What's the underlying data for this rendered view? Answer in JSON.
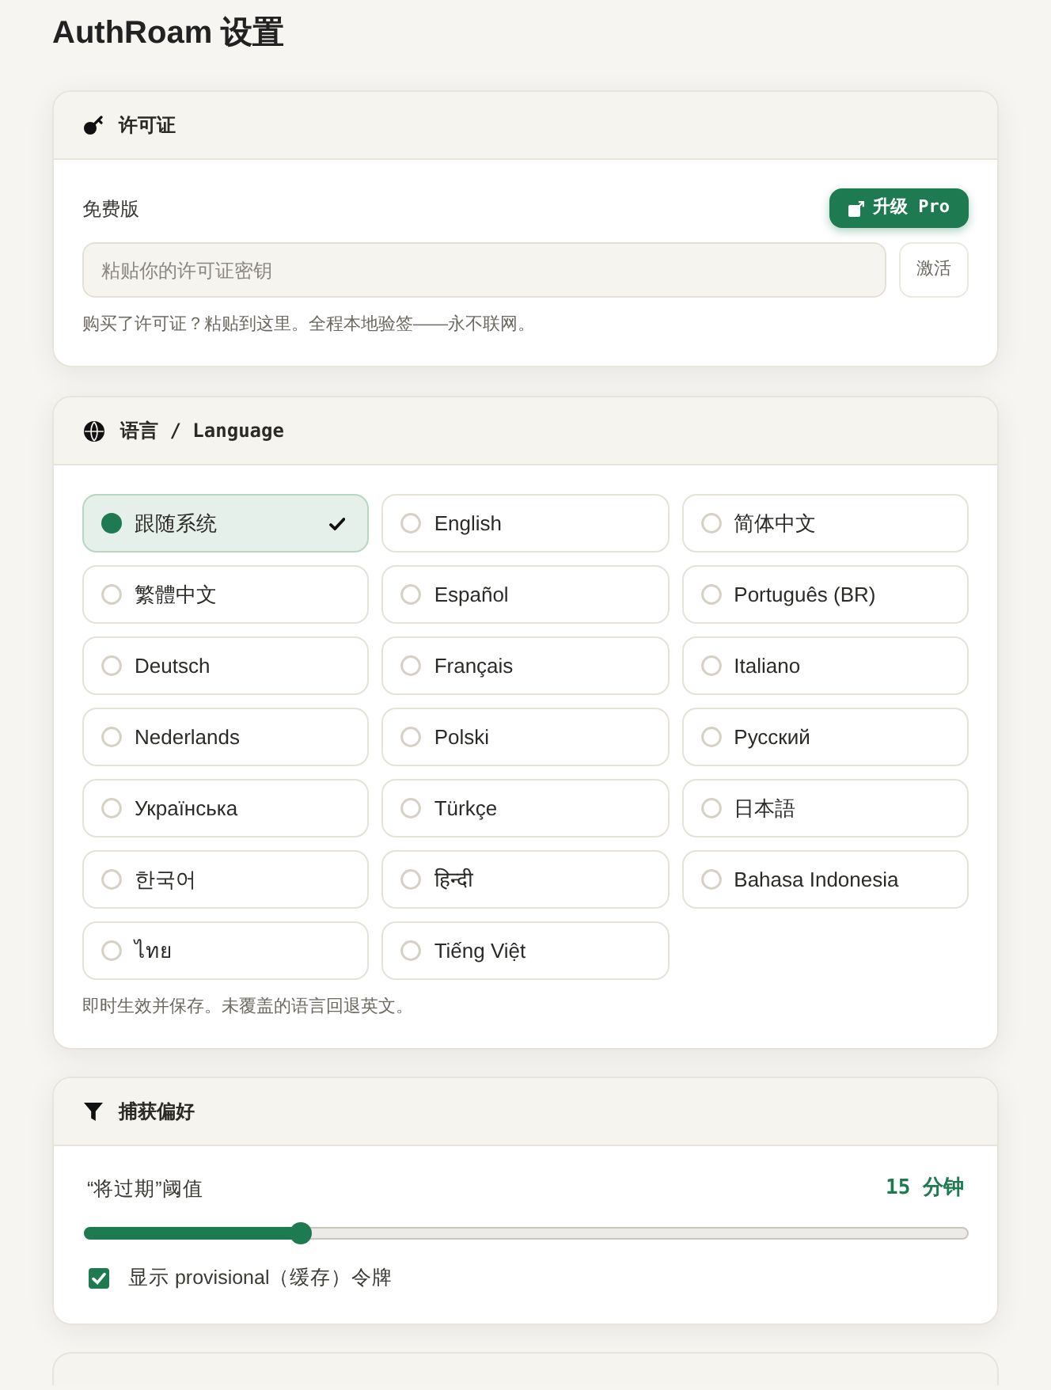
{
  "page": {
    "title": "AuthRoam 设置"
  },
  "license": {
    "header": {
      "title": "许可证"
    },
    "plan": "免费版",
    "upgrade_button": "升级 Pro",
    "key_field": {
      "placeholder": "粘贴你的许可证密钥"
    },
    "activate_button": "激活",
    "hint": "购买了许可证？粘贴到这里。全程本地验签——永不联网。"
  },
  "language": {
    "header": {
      "title": "语言 / Language"
    },
    "options": [
      {
        "label": "跟随系统",
        "selected": true
      },
      {
        "label": "English",
        "selected": false
      },
      {
        "label": "简体中文",
        "selected": false
      },
      {
        "label": "繁體中文",
        "selected": false
      },
      {
        "label": "Español",
        "selected": false
      },
      {
        "label": "Português (BR)",
        "selected": false
      },
      {
        "label": "Deutsch",
        "selected": false
      },
      {
        "label": "Français",
        "selected": false
      },
      {
        "label": "Italiano",
        "selected": false
      },
      {
        "label": "Nederlands",
        "selected": false
      },
      {
        "label": "Polski",
        "selected": false
      },
      {
        "label": "Русский",
        "selected": false
      },
      {
        "label": "Українська",
        "selected": false
      },
      {
        "label": "Türkçe",
        "selected": false
      },
      {
        "label": "日本語",
        "selected": false
      },
      {
        "label": "한국어",
        "selected": false
      },
      {
        "label": "हिन्दी",
        "selected": false
      },
      {
        "label": "Bahasa Indonesia",
        "selected": false
      },
      {
        "label": "ไทย",
        "selected": false
      },
      {
        "label": "Tiếng Việt",
        "selected": false
      }
    ],
    "hint": "即时生效并保存。未覆盖的语言回退英文。"
  },
  "capture": {
    "header": {
      "title": "捕获偏好"
    },
    "threshold": {
      "label": "“将过期”阈值",
      "reading": "15 分钟",
      "level": 0.245
    },
    "provisional": {
      "label": "显示 provisional（缓存）令牌",
      "checked": true
    }
  }
}
